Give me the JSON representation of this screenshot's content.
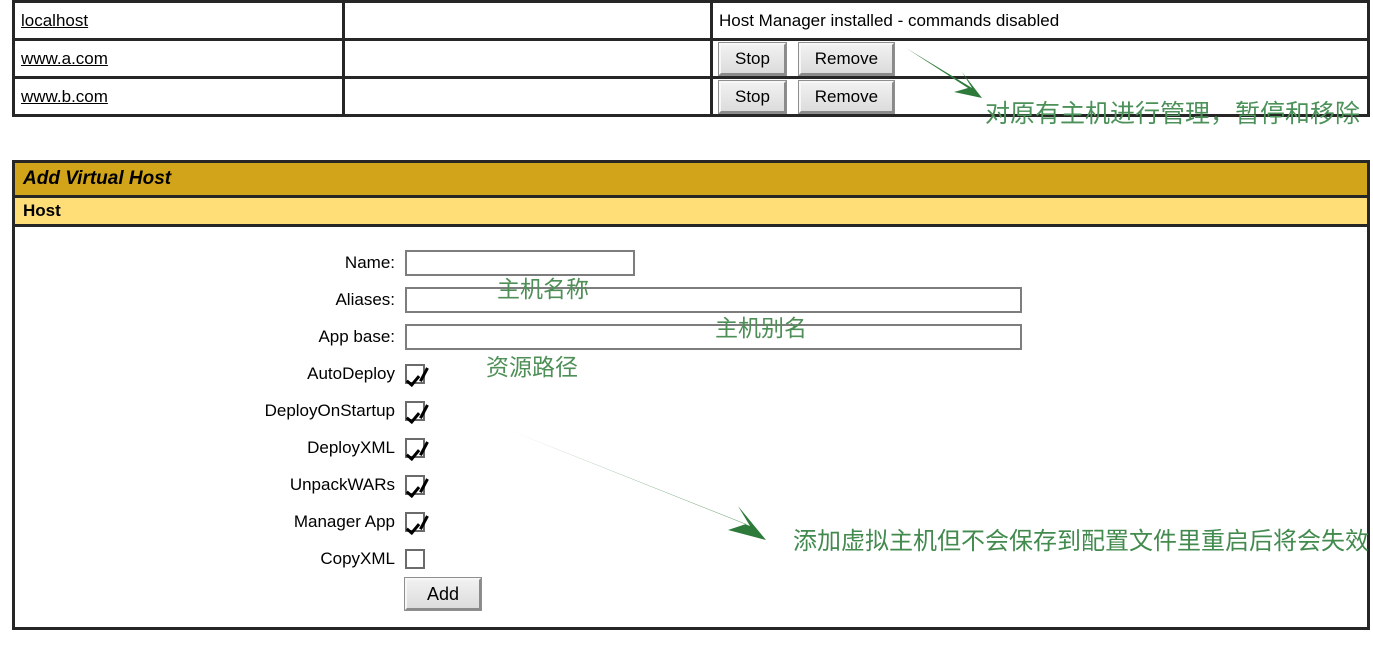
{
  "host_table": {
    "columns": [
      "host-name",
      "host-aliases",
      "host-commands"
    ],
    "rows": [
      {
        "name": "localhost",
        "aliases": "",
        "message": "Host Manager installed - commands disabled",
        "has_buttons": false,
        "buttons": []
      },
      {
        "name": "www.a.com",
        "aliases": "",
        "message": "",
        "has_buttons": true,
        "buttons": [
          "Stop",
          "Remove"
        ]
      },
      {
        "name": "www.b.com",
        "aliases": "",
        "message": "",
        "has_buttons": true,
        "buttons": [
          "Stop",
          "Remove"
        ]
      }
    ]
  },
  "add_panel": {
    "title": "Add Virtual Host",
    "subtitle": "Host",
    "fields": [
      {
        "label": "Name:",
        "value": "",
        "placeholder": "",
        "type": "text",
        "width": "name"
      },
      {
        "label": "Aliases:",
        "value": "",
        "placeholder": "",
        "type": "text",
        "width": "wide"
      },
      {
        "label": "App base:",
        "value": "",
        "placeholder": "",
        "type": "text",
        "width": "wide"
      }
    ],
    "checkboxes": [
      {
        "label": "AutoDeploy",
        "checked": true
      },
      {
        "label": "DeployOnStartup",
        "checked": true
      },
      {
        "label": "DeployXML",
        "checked": true
      },
      {
        "label": "UnpackWARs",
        "checked": true
      },
      {
        "label": "Manager App",
        "checked": true
      },
      {
        "label": "CopyXML",
        "checked": false
      }
    ],
    "submit_label": "Add"
  },
  "annotations": {
    "manage_hosts": "对原有主机进行管理，暂停和移除",
    "host_name": "主机名称",
    "host_alias": "主机别名",
    "resource_path": "资源路径",
    "add_note": "添加虚拟主机但不会保存到配置文件里重启后将会失效",
    "color": "#3f8a4a"
  },
  "colors": {
    "panel_title_bg": "#d2a419",
    "panel_sub_bg": "#ffdd77",
    "table_border": "#262626",
    "annotation_green": "#3f8a4a",
    "button_face": "#dcdcdc"
  }
}
